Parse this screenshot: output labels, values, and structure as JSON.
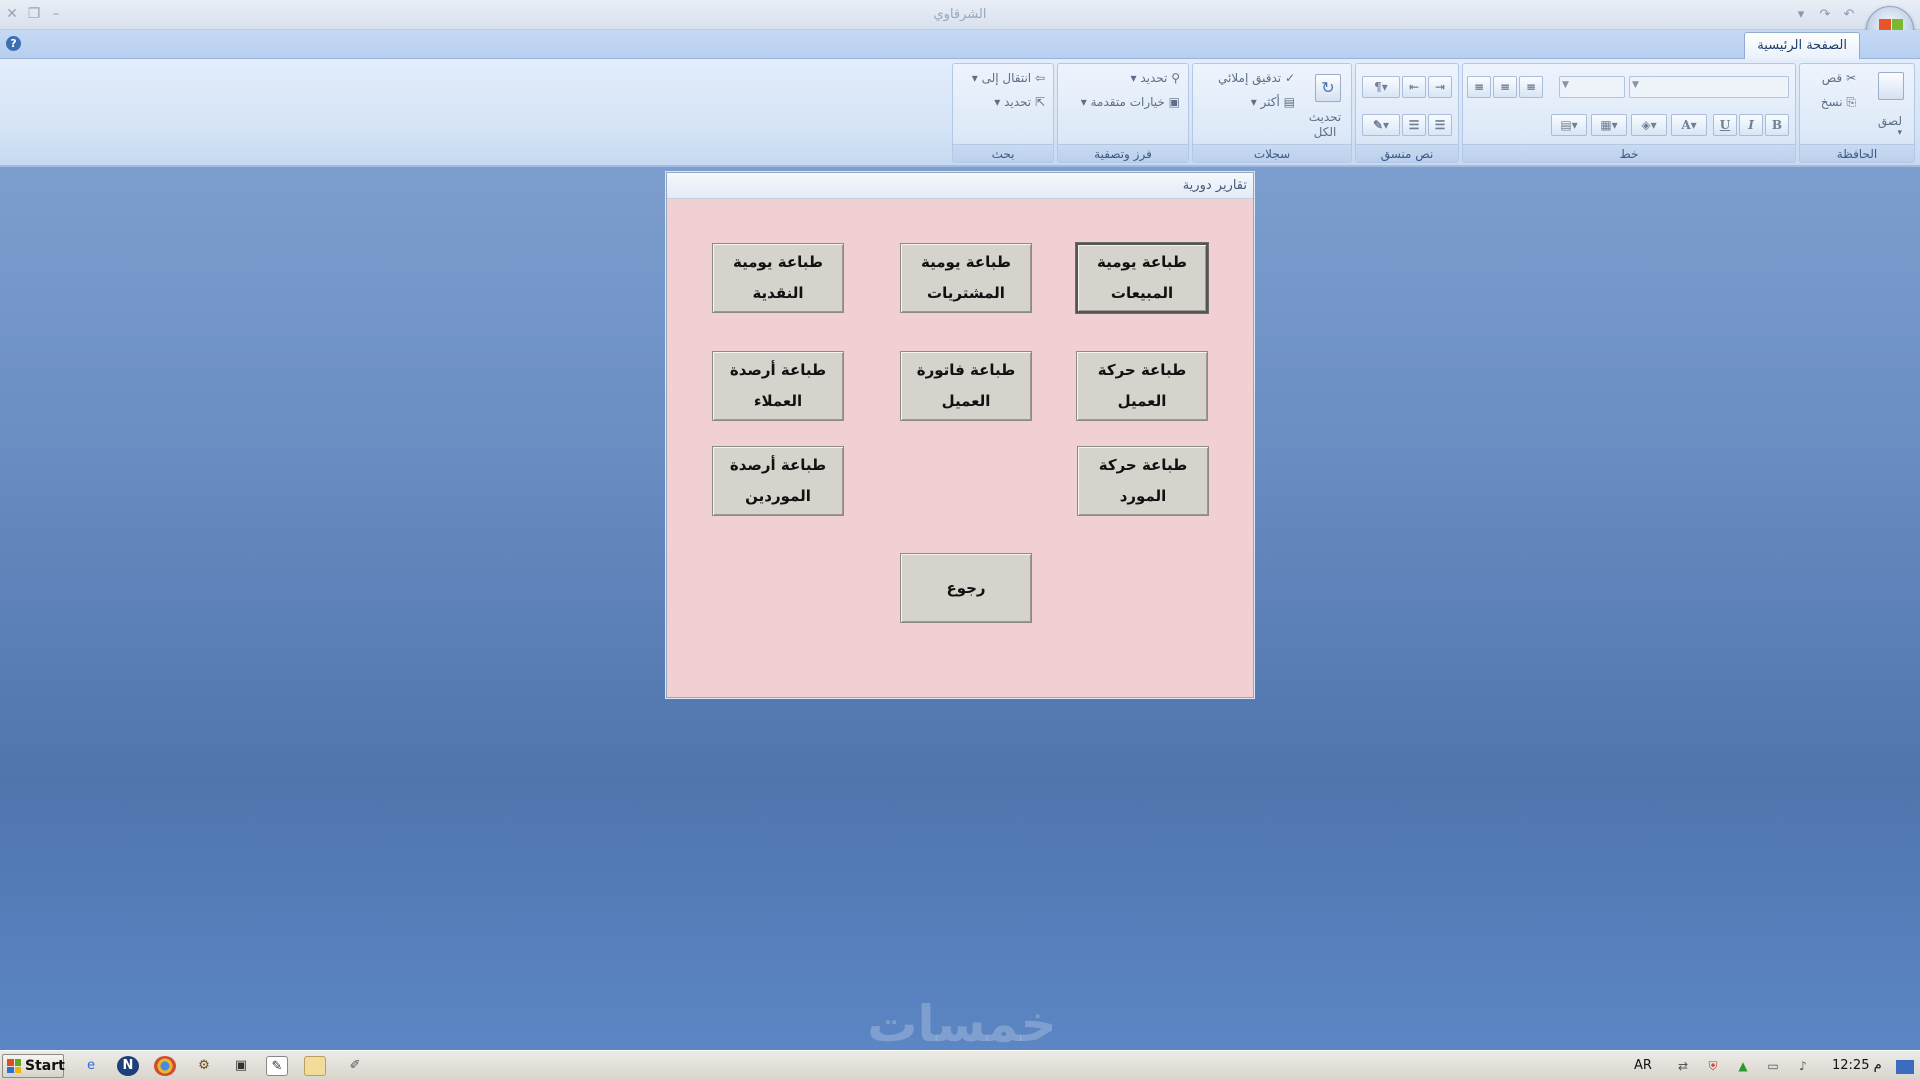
{
  "window": {
    "title": "الشرقاوي",
    "help": "?"
  },
  "tabs": {
    "home": "الصفحة الرئيسية"
  },
  "ribbon": {
    "clipboard": {
      "label": "الحافظة",
      "paste": "لصق",
      "cut": "قص",
      "copy": "نسخ"
    },
    "font": {
      "label": "خط",
      "bold": "B",
      "italic": "I",
      "underline": "U"
    },
    "rich_text": {
      "label": "نص منسق"
    },
    "records": {
      "label": "سجلات",
      "refresh_all": "تحديث الكل",
      "spelling": "تدقيق إملائي",
      "more": "أكثر"
    },
    "sort_filter": {
      "label": "فرز وتصفية",
      "selection": "تحديد",
      "advanced": "خيارات متقدمة"
    },
    "find": {
      "label": "بحث",
      "goto": "انتقال إلى",
      "select": "تحديد"
    }
  },
  "dialog": {
    "title": "تقارير دورية",
    "buttons": {
      "daily_sales": "طباعة يومية المبيعات",
      "daily_purchases": "طباعة يومية المشتريات",
      "daily_cash": "طباعة يومية النقدية",
      "customer_movement": "طباعة حركة العميل",
      "customer_invoice": "طباعة فاتورة العميل",
      "customer_balances": "طباعة أرصدة العملاء",
      "supplier_movement": "طباعة حركة المورد",
      "supplier_balances": "طباعة أرصدة الموردين",
      "back": "رجوع"
    }
  },
  "watermark": "خمسات",
  "taskbar": {
    "start": "Start",
    "language": "AR",
    "clock": "12:25 م"
  },
  "colors": {
    "dialog_background": "#f0d0d2",
    "desktop": "#5f86bf",
    "button_face": "#d6d2cc"
  },
  "icons": {
    "ie": "ie-icon",
    "n_app": "n-app-icon",
    "chrome": "chrome-icon",
    "tool": "tool-icon",
    "app": "app-icon",
    "paint": "paint-icon",
    "folder": "folder-icon",
    "brush": "brush-icon"
  }
}
